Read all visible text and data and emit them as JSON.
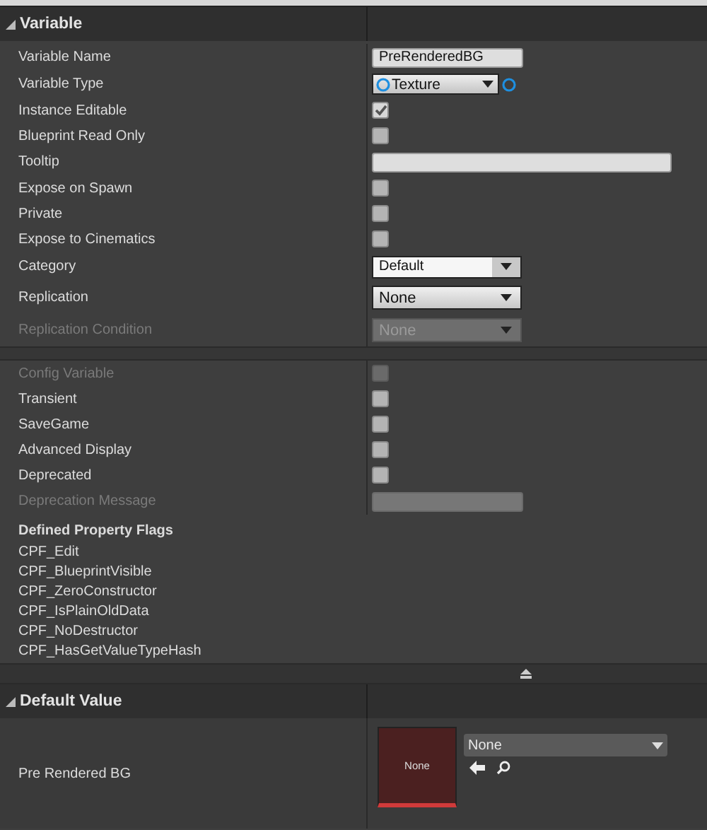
{
  "variable_section": {
    "title": "Variable",
    "expanded": true
  },
  "properties": [
    {
      "label": "Variable Name",
      "kind": "text",
      "value": "PreRenderedBG",
      "disabled": false
    },
    {
      "label": "Variable Type",
      "kind": "type",
      "value": "Texture",
      "disabled": false
    },
    {
      "label": "Instance Editable",
      "kind": "checkbox",
      "checked": true,
      "disabled": false
    },
    {
      "label": "Blueprint Read Only",
      "kind": "checkbox",
      "checked": false,
      "disabled": false
    },
    {
      "label": "Tooltip",
      "kind": "wide",
      "disabled": false
    },
    {
      "label": "Expose on Spawn",
      "kind": "checkbox",
      "checked": false,
      "disabled": false
    },
    {
      "label": "Private",
      "kind": "checkbox",
      "checked": false,
      "disabled": false
    },
    {
      "label": "Expose to Cinematics",
      "kind": "checkbox",
      "checked": false,
      "disabled": false
    },
    {
      "label": "Category",
      "kind": "combo",
      "value": "Default",
      "disabled": false
    },
    {
      "label": "Replication",
      "kind": "dropdown",
      "value": "None",
      "disabled": false
    },
    {
      "label": "Replication Condition",
      "kind": "dropdown",
      "value": "None",
      "disabled": true
    }
  ],
  "advanced_properties": [
    {
      "label": "Config Variable",
      "kind": "checkbox",
      "checked": false,
      "disabled": true
    },
    {
      "label": "Transient",
      "kind": "checkbox",
      "checked": false,
      "disabled": false
    },
    {
      "label": "SaveGame",
      "kind": "checkbox",
      "checked": false,
      "disabled": false
    },
    {
      "label": "Advanced Display",
      "kind": "checkbox",
      "checked": false,
      "disabled": false
    },
    {
      "label": "Deprecated",
      "kind": "checkbox",
      "checked": false,
      "disabled": false
    },
    {
      "label": "Deprecation Message",
      "kind": "text",
      "disabled": true
    }
  ],
  "property_flags": {
    "title": "Defined Property Flags",
    "flags": [
      "CPF_Edit",
      "CPF_BlueprintVisible",
      "CPF_ZeroConstructor",
      "CPF_IsPlainOldData",
      "CPF_NoDestructor",
      "CPF_HasGetValueTypeHash"
    ]
  },
  "default_section": {
    "title": "Default Value",
    "expanded": true
  },
  "default_value": {
    "label": "Pre Rendered BG",
    "thumbnail": "None",
    "asset": "None"
  }
}
